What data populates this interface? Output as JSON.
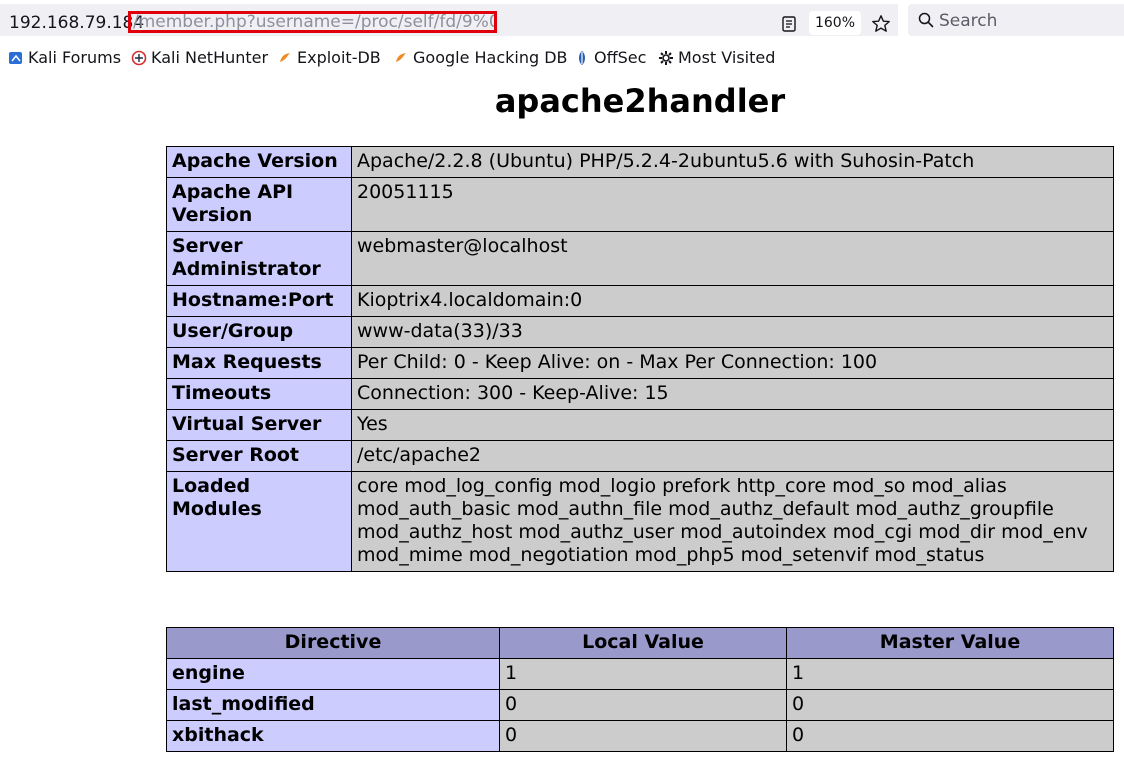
{
  "browser": {
    "url_host": "192.168.79.184",
    "url_path": "/member.php?username=/proc/self/fd/9%00",
    "zoom": "160%",
    "search_placeholder": "Search",
    "highlight_color": "#e0000b"
  },
  "bookmarks": [
    {
      "label": "Kali Forums",
      "icon": "kali-forums-icon"
    },
    {
      "label": "Kali NetHunter",
      "icon": "kali-nethunter-icon"
    },
    {
      "label": "Exploit-DB",
      "icon": "exploit-db-icon"
    },
    {
      "label": "Google Hacking DB",
      "icon": "ghdb-icon"
    },
    {
      "label": "OffSec",
      "icon": "offsec-icon"
    },
    {
      "label": "Most Visited",
      "icon": "gear-icon"
    }
  ],
  "page": {
    "title": "apache2handler",
    "colors": {
      "header": "#9999cc",
      "label": "#ccccff",
      "value": "#cccccc"
    },
    "apache_info": [
      {
        "label": "Apache Version",
        "value": "Apache/2.2.8 (Ubuntu) PHP/5.2.4-2ubuntu5.6 with Suhosin-Patch"
      },
      {
        "label": "Apache API Version",
        "value": "20051115"
      },
      {
        "label": "Server Administrator",
        "value": "webmaster@localhost"
      },
      {
        "label": "Hostname:Port",
        "value": "Kioptrix4.localdomain:0"
      },
      {
        "label": "User/Group",
        "value": "www-data(33)/33"
      },
      {
        "label": "Max Requests",
        "value": "Per Child: 0 - Keep Alive: on - Max Per Connection: 100"
      },
      {
        "label": "Timeouts",
        "value": "Connection: 300 - Keep-Alive: 15"
      },
      {
        "label": "Virtual Server",
        "value": "Yes"
      },
      {
        "label": "Server Root",
        "value": "/etc/apache2"
      },
      {
        "label": "Loaded Modules",
        "value": "core mod_log_config mod_logio prefork http_core mod_so mod_alias mod_auth_basic mod_authn_file mod_authz_default mod_authz_groupfile mod_authz_host mod_authz_user mod_autoindex mod_cgi mod_dir mod_env mod_mime mod_negotiation mod_php5 mod_setenvif mod_status"
      }
    ],
    "directives": {
      "headers": [
        "Directive",
        "Local Value",
        "Master Value"
      ],
      "rows": [
        [
          "engine",
          "1",
          "1"
        ],
        [
          "last_modified",
          "0",
          "0"
        ],
        [
          "xbithack",
          "0",
          "0"
        ]
      ]
    }
  }
}
